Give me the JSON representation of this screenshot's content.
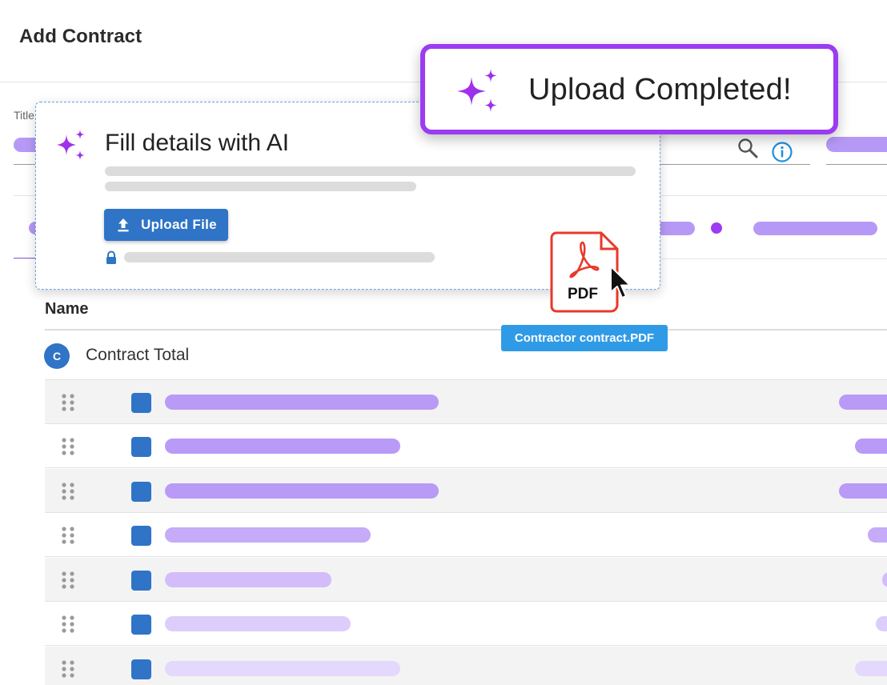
{
  "header": {
    "title": "Add Contract"
  },
  "form": {
    "title_label": "Title"
  },
  "table": {
    "name_header": "Name",
    "total": {
      "avatar_letter": "C",
      "label": "Contract Total"
    }
  },
  "fill_card": {
    "title": "Fill details with AI",
    "upload_button": "Upload File",
    "upload_icon": "upload-icon",
    "lock_icon": "lock-icon"
  },
  "toast": {
    "message": "Upload Completed!",
    "icon": "sparkle-icon"
  },
  "file": {
    "type_label": "PDF",
    "name": "Contractor contract.PDF"
  },
  "colors": {
    "primary": "#2f74c6",
    "accent_purple": "#9b3bf2",
    "placeholder_purple": "#b699f6",
    "file_red": "#e8392a"
  }
}
